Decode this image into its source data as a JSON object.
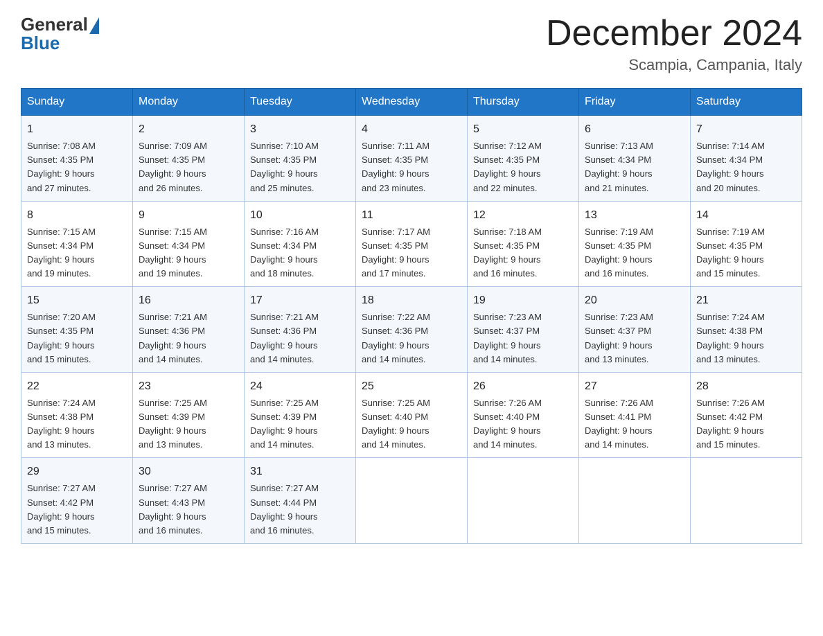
{
  "header": {
    "logo_general": "General",
    "logo_blue": "Blue",
    "month_year": "December 2024",
    "location": "Scampia, Campania, Italy"
  },
  "days_of_week": [
    "Sunday",
    "Monday",
    "Tuesday",
    "Wednesday",
    "Thursday",
    "Friday",
    "Saturday"
  ],
  "weeks": [
    [
      {
        "day": "1",
        "sunrise": "7:08 AM",
        "sunset": "4:35 PM",
        "daylight": "9 hours and 27 minutes."
      },
      {
        "day": "2",
        "sunrise": "7:09 AM",
        "sunset": "4:35 PM",
        "daylight": "9 hours and 26 minutes."
      },
      {
        "day": "3",
        "sunrise": "7:10 AM",
        "sunset": "4:35 PM",
        "daylight": "9 hours and 25 minutes."
      },
      {
        "day": "4",
        "sunrise": "7:11 AM",
        "sunset": "4:35 PM",
        "daylight": "9 hours and 23 minutes."
      },
      {
        "day": "5",
        "sunrise": "7:12 AM",
        "sunset": "4:35 PM",
        "daylight": "9 hours and 22 minutes."
      },
      {
        "day": "6",
        "sunrise": "7:13 AM",
        "sunset": "4:34 PM",
        "daylight": "9 hours and 21 minutes."
      },
      {
        "day": "7",
        "sunrise": "7:14 AM",
        "sunset": "4:34 PM",
        "daylight": "9 hours and 20 minutes."
      }
    ],
    [
      {
        "day": "8",
        "sunrise": "7:15 AM",
        "sunset": "4:34 PM",
        "daylight": "9 hours and 19 minutes."
      },
      {
        "day": "9",
        "sunrise": "7:15 AM",
        "sunset": "4:34 PM",
        "daylight": "9 hours and 19 minutes."
      },
      {
        "day": "10",
        "sunrise": "7:16 AM",
        "sunset": "4:34 PM",
        "daylight": "9 hours and 18 minutes."
      },
      {
        "day": "11",
        "sunrise": "7:17 AM",
        "sunset": "4:35 PM",
        "daylight": "9 hours and 17 minutes."
      },
      {
        "day": "12",
        "sunrise": "7:18 AM",
        "sunset": "4:35 PM",
        "daylight": "9 hours and 16 minutes."
      },
      {
        "day": "13",
        "sunrise": "7:19 AM",
        "sunset": "4:35 PM",
        "daylight": "9 hours and 16 minutes."
      },
      {
        "day": "14",
        "sunrise": "7:19 AM",
        "sunset": "4:35 PM",
        "daylight": "9 hours and 15 minutes."
      }
    ],
    [
      {
        "day": "15",
        "sunrise": "7:20 AM",
        "sunset": "4:35 PM",
        "daylight": "9 hours and 15 minutes."
      },
      {
        "day": "16",
        "sunrise": "7:21 AM",
        "sunset": "4:36 PM",
        "daylight": "9 hours and 14 minutes."
      },
      {
        "day": "17",
        "sunrise": "7:21 AM",
        "sunset": "4:36 PM",
        "daylight": "9 hours and 14 minutes."
      },
      {
        "day": "18",
        "sunrise": "7:22 AM",
        "sunset": "4:36 PM",
        "daylight": "9 hours and 14 minutes."
      },
      {
        "day": "19",
        "sunrise": "7:23 AM",
        "sunset": "4:37 PM",
        "daylight": "9 hours and 14 minutes."
      },
      {
        "day": "20",
        "sunrise": "7:23 AM",
        "sunset": "4:37 PM",
        "daylight": "9 hours and 13 minutes."
      },
      {
        "day": "21",
        "sunrise": "7:24 AM",
        "sunset": "4:38 PM",
        "daylight": "9 hours and 13 minutes."
      }
    ],
    [
      {
        "day": "22",
        "sunrise": "7:24 AM",
        "sunset": "4:38 PM",
        "daylight": "9 hours and 13 minutes."
      },
      {
        "day": "23",
        "sunrise": "7:25 AM",
        "sunset": "4:39 PM",
        "daylight": "9 hours and 13 minutes."
      },
      {
        "day": "24",
        "sunrise": "7:25 AM",
        "sunset": "4:39 PM",
        "daylight": "9 hours and 14 minutes."
      },
      {
        "day": "25",
        "sunrise": "7:25 AM",
        "sunset": "4:40 PM",
        "daylight": "9 hours and 14 minutes."
      },
      {
        "day": "26",
        "sunrise": "7:26 AM",
        "sunset": "4:40 PM",
        "daylight": "9 hours and 14 minutes."
      },
      {
        "day": "27",
        "sunrise": "7:26 AM",
        "sunset": "4:41 PM",
        "daylight": "9 hours and 14 minutes."
      },
      {
        "day": "28",
        "sunrise": "7:26 AM",
        "sunset": "4:42 PM",
        "daylight": "9 hours and 15 minutes."
      }
    ],
    [
      {
        "day": "29",
        "sunrise": "7:27 AM",
        "sunset": "4:42 PM",
        "daylight": "9 hours and 15 minutes."
      },
      {
        "day": "30",
        "sunrise": "7:27 AM",
        "sunset": "4:43 PM",
        "daylight": "9 hours and 16 minutes."
      },
      {
        "day": "31",
        "sunrise": "7:27 AM",
        "sunset": "4:44 PM",
        "daylight": "9 hours and 16 minutes."
      },
      null,
      null,
      null,
      null
    ]
  ],
  "labels": {
    "sunrise": "Sunrise:",
    "sunset": "Sunset:",
    "daylight": "Daylight:"
  }
}
